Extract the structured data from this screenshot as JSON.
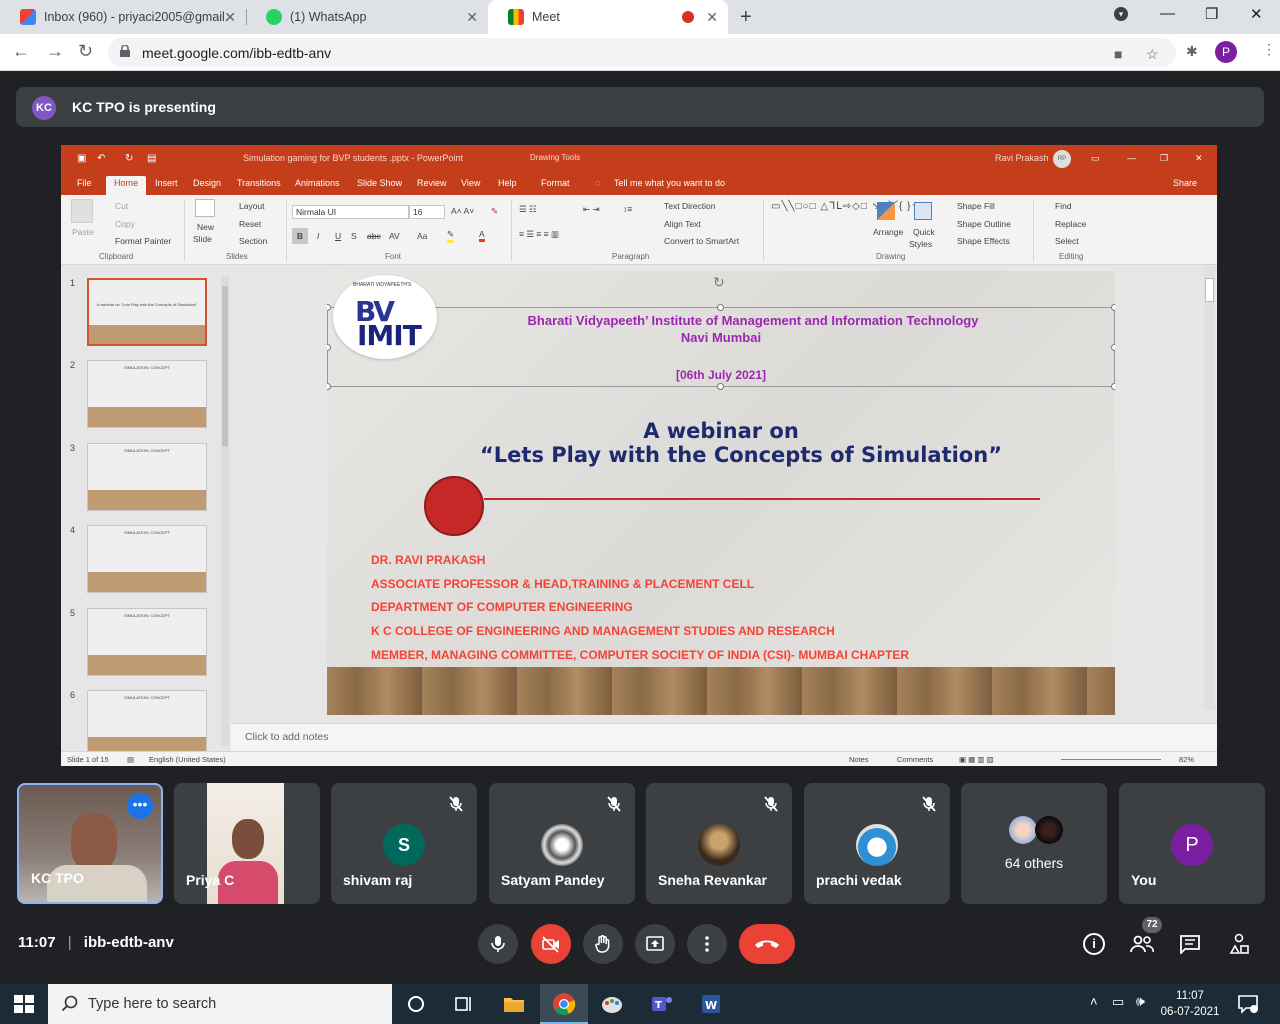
{
  "browser": {
    "tabs": [
      {
        "title": "Inbox (960) - priyaci2005@gmail.",
        "icon": "gmail-icon"
      },
      {
        "title": "(1) WhatsApp",
        "icon": "whatsapp-icon"
      },
      {
        "title": "Meet",
        "icon": "meet-icon"
      }
    ],
    "url": "meet.google.com/ibb-edtb-anv",
    "profile_initial": "P"
  },
  "meet": {
    "presenter_initials": "KC",
    "presenting_text": "KC TPO is presenting",
    "meeting_time": "11:07",
    "meeting_code": "ibb-edtb-anv",
    "participant_count": "72",
    "tiles": [
      {
        "name": "KC TPO"
      },
      {
        "name": "Priya C"
      },
      {
        "name": "shivam raj",
        "initial": "S"
      },
      {
        "name": "Satyam Pandey"
      },
      {
        "name": "Sneha Revankar"
      },
      {
        "name": "prachi vedak"
      },
      {
        "name": "64 others"
      },
      {
        "name": "You",
        "initial": "P"
      }
    ]
  },
  "ppt": {
    "doc_title": "Simulation gaming for BVP students .pptx  -  PowerPoint",
    "context_tab": "Drawing Tools",
    "user": "Ravi Prakash",
    "user_initials": "RP",
    "tabs": [
      "File",
      "Home",
      "Insert",
      "Design",
      "Transitions",
      "Animations",
      "Slide Show",
      "Review",
      "View",
      "Help",
      "Format"
    ],
    "tell_me": "Tell me what you want to do",
    "share": "Share",
    "ribbon": {
      "clipboard": {
        "paste": "Paste",
        "cut": "Cut",
        "copy": "Copy",
        "format_painter": "Format Painter",
        "label": "Clipboard"
      },
      "slides": {
        "new_slide_1": "New",
        "new_slide_2": "Slide",
        "layout": "Layout",
        "reset": "Reset",
        "section": "Section",
        "label": "Slides"
      },
      "font": {
        "name": "Nirmala UI",
        "size": "16",
        "label": "Font"
      },
      "paragraph": {
        "text_direction": "Text Direction",
        "align_text": "Align Text",
        "convert_smartart": "Convert to SmartArt",
        "label": "Paragraph"
      },
      "drawing": {
        "arrange": "Arrange",
        "quick_styles_1": "Quick",
        "quick_styles_2": "Styles",
        "shape_fill": "Shape Fill",
        "shape_outline": "Shape Outline",
        "shape_effects": "Shape Effects",
        "label": "Drawing"
      },
      "editing": {
        "find": "Find",
        "replace": "Replace",
        "select": "Select",
        "label": "Editing"
      }
    },
    "thumbnails": [
      {
        "num": "1",
        "title": "A webinar on \"Lets Play with the Concepts of Simulation\""
      },
      {
        "num": "2",
        "title": "SIMULATION: CONCEPT"
      },
      {
        "num": "3",
        "title": "SIMULATION: CONCEPT"
      },
      {
        "num": "4",
        "title": "SIMULATION: CONCEPT"
      },
      {
        "num": "5",
        "title": "SIMULATION: CONCEPT"
      },
      {
        "num": "6",
        "title": "SIMULATION: CONCEPT"
      }
    ],
    "slide": {
      "logo_arc": "BHARATI VIDYAPEETH'S",
      "logo_top": "BV",
      "logo_bottom": "IMIT",
      "institute_line1": "Bharati Vidyapeeth’ Institute of Management and Information Technology",
      "institute_line2": "Navi Mumbai",
      "date": "[06th July 2021]",
      "webinar_line1": "A webinar on",
      "webinar_line2": "“Lets Play with the Concepts of Simulation”",
      "credits": [
        "DR. RAVI PRAKASH",
        "ASSOCIATE PROFESSOR & HEAD,TRAINING & PLACEMENT CELL",
        " DEPARTMENT OF COMPUTER ENGINEERING",
        "K C COLLEGE OF ENGINEERING AND MANAGEMENT STUDIES AND RESEARCH",
        "MEMBER, MANAGING COMMITTEE, COMPUTER SOCIETY OF INDIA (CSI)- MUMBAI CHAPTER"
      ]
    },
    "notes_placeholder": "Click to add notes",
    "status": {
      "slide_of": "Slide 1 of 15",
      "language": "English (United States)",
      "notes": "Notes",
      "comments": "Comments",
      "zoom": "82%"
    }
  },
  "taskbar": {
    "search_placeholder": "Type here to search",
    "time": "11:07",
    "date": "06-07-2021"
  },
  "colors": {
    "ppt_accent": "#c43e1c",
    "meet_dark": "#202124",
    "leave_red": "#ea4335"
  }
}
